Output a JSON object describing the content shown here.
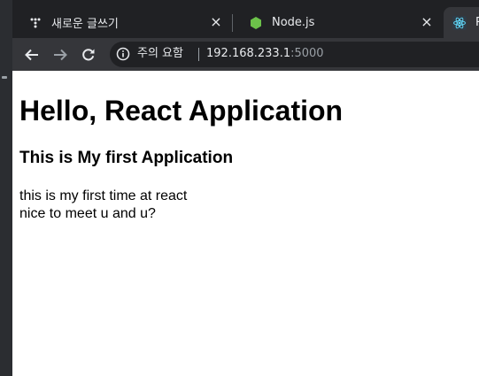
{
  "tabs": [
    {
      "title": "새로운 글쓰기",
      "icon": "tistory-icon",
      "close": "×"
    },
    {
      "title": "Node.js",
      "icon": "nodejs-icon",
      "close": "×"
    },
    {
      "title": "R",
      "icon": "react-icon",
      "active": true
    }
  ],
  "toolbar": {
    "back": "back-arrow-icon",
    "forward": "forward-arrow-icon",
    "reload": "reload-icon"
  },
  "omnibox": {
    "security_icon": "info-icon",
    "security_warning": "주의 요함",
    "url_host": "192.168.233.1",
    "url_port": ":5000"
  },
  "page": {
    "heading": "Hello, React Application",
    "subheading": "This is My first Application",
    "lines": [
      "this is my first time at react",
      "nice to meet u and u?"
    ]
  },
  "colors": {
    "tabstrip": "#202124",
    "toolbar": "#35363a",
    "nodejs_green": "#6cc24a",
    "react_cyan": "#61dafb"
  }
}
